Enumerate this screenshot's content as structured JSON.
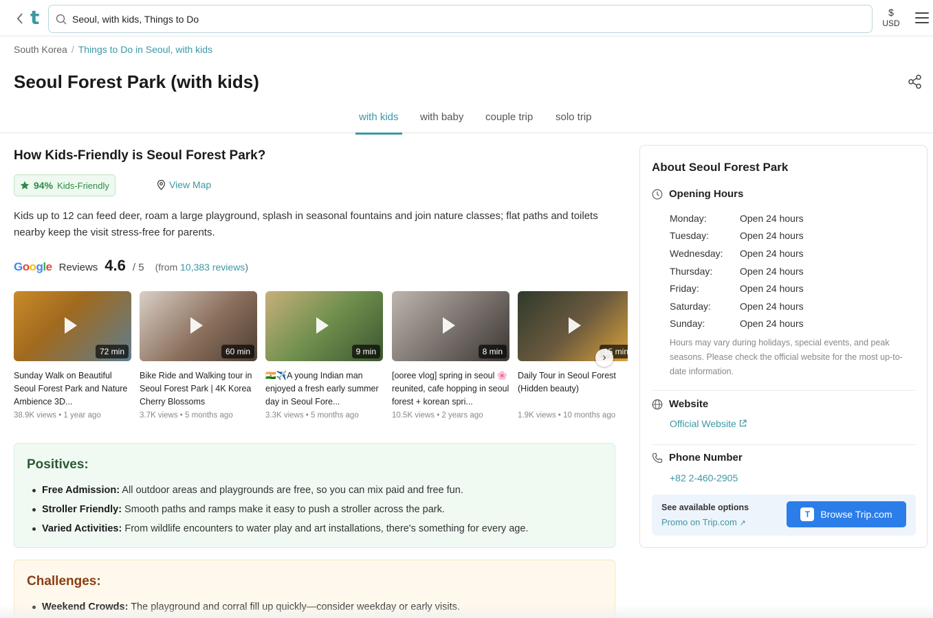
{
  "topbar": {
    "logo": "t",
    "search_value": "Seoul, with kids, Things to Do",
    "currency_symbol": "$",
    "currency_code": "USD"
  },
  "breadcrumb": {
    "root": "South Korea",
    "separator": "/",
    "current": "Things to Do in Seoul, with kids"
  },
  "page_title": "Seoul Forest Park (with kids)",
  "tabs": [
    {
      "label": "with kids",
      "active": true
    },
    {
      "label": "with baby",
      "active": false
    },
    {
      "label": "couple trip",
      "active": false
    },
    {
      "label": "solo trip",
      "active": false
    }
  ],
  "kids_friendly": {
    "heading": "How Kids-Friendly is Seoul Forest Park?",
    "percent": "94%",
    "badge_label": "Kids-Friendly",
    "view_map": "View Map",
    "description": "Kids up to 12 can feed deer, roam a large playground, splash in seasonal fountains and join nature classes; flat paths and toilets nearby keep the visit stress-free for parents."
  },
  "reviews": {
    "label": "Reviews",
    "rating": "4.6",
    "out_of": "/ 5",
    "from_prefix": "(from ",
    "count_text": "10,383 reviews",
    "from_suffix": ")"
  },
  "videos": [
    {
      "duration": "72 min",
      "title": "Sunday Walk on Beautiful Seoul Forest Park and Nature Ambience 3D...",
      "meta": "38.9K views • 1 year ago",
      "colors": [
        "#c98a2a",
        "#5f7d8f"
      ]
    },
    {
      "duration": "60 min",
      "title": "Bike Ride and Walking tour in Seoul Forest Park | 4K Korea Cherry Blossoms",
      "meta": "3.7K views • 5 months ago",
      "colors": [
        "#8b6f5c",
        "#d9cfc6"
      ]
    },
    {
      "duration": "9 min",
      "title": "🇮🇳✈️A young Indian man enjoyed a fresh early summer day in Seoul Fore...",
      "meta": "3.3K views • 5 months ago",
      "colors": [
        "#6f8f4e",
        "#c7b07a"
      ]
    },
    {
      "duration": "8 min",
      "title": "[ooree vlog] spring in seoul 🌸 reunited, cafe hopping in seoul forest + korean spri...",
      "meta": "10.5K views • 2 years ago",
      "colors": [
        "#7d7570",
        "#bdb5ae"
      ]
    },
    {
      "duration": "15 min",
      "title": "Daily Tour in Seoul Forest (Hidden beauty)",
      "meta": "1.9K views • 10 months ago",
      "colors": [
        "#2f3a2c",
        "#e3a83a"
      ]
    }
  ],
  "positives": {
    "heading": "Positives:",
    "items": [
      {
        "label": "Free Admission:",
        "text": " All outdoor areas and playgrounds are free, so you can mix paid and free fun."
      },
      {
        "label": "Stroller Friendly:",
        "text": " Smooth paths and ramps make it easy to push a stroller across the park."
      },
      {
        "label": "Varied Activities:",
        "text": " From wildlife encounters to water play and art installations, there's something for every age."
      }
    ]
  },
  "challenges": {
    "heading": "Challenges:",
    "items": [
      {
        "label": "Weekend Crowds:",
        "text": " The playground and corral fill up quickly—consider weekday or early visits."
      }
    ]
  },
  "about": {
    "title": "About Seoul Forest Park",
    "opening_hours_label": "Opening Hours",
    "hours": [
      {
        "day": "Monday:",
        "time": "Open 24 hours"
      },
      {
        "day": "Tuesday:",
        "time": "Open 24 hours"
      },
      {
        "day": "Wednesday:",
        "time": "Open 24 hours"
      },
      {
        "day": "Thursday:",
        "time": "Open 24 hours"
      },
      {
        "day": "Friday:",
        "time": "Open 24 hours"
      },
      {
        "day": "Saturday:",
        "time": "Open 24 hours"
      },
      {
        "day": "Sunday:",
        "time": "Open 24 hours"
      }
    ],
    "hours_note": "Hours may vary during holidays, special events, and peak seasons. Please check the official website for the most up-to-date information.",
    "website_label": "Website",
    "website_link": "Official Website",
    "phone_label": "Phone Number",
    "phone": "+82 2-460-2905",
    "promo_label": "See available options",
    "promo_link": "Promo on Trip.com",
    "browse_badge": "T",
    "browse_label": "Browse Trip.com"
  },
  "colors": {
    "accent": "#3a98a4",
    "green": "#2e8b45",
    "button_blue": "#2b7de9"
  }
}
